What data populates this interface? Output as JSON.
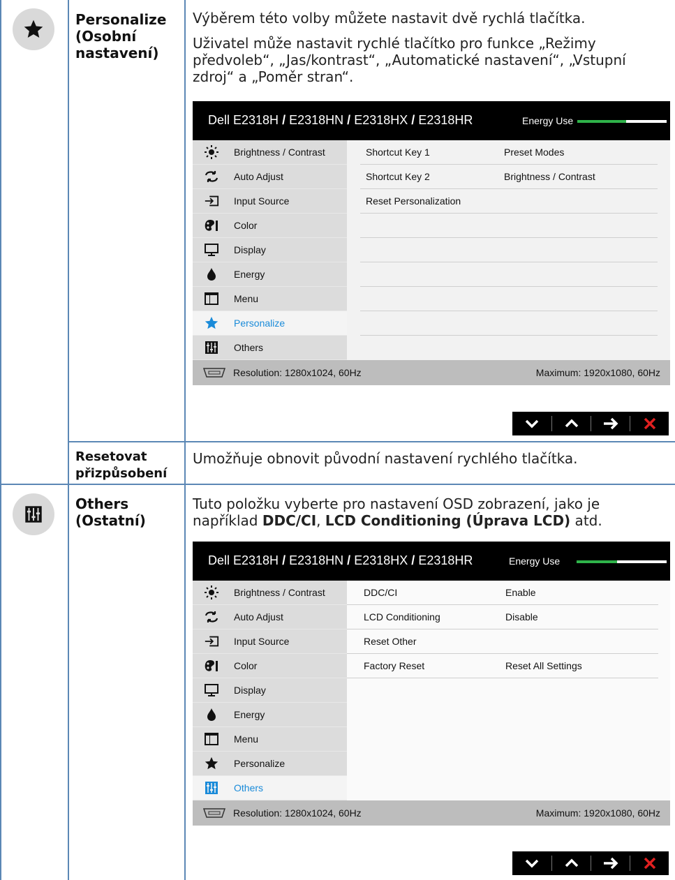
{
  "sections": [
    {
      "icon": "star-icon",
      "name_lines": [
        "Personalize",
        "(Osobní",
        "nastavení)"
      ],
      "desc_lines": [
        "Výběrem této volby můžete nastavit dvě rychlá tlačítka.",
        "Uživatel může nastavit rychlé tlačítko pro funkce „Režimy",
        "předvoleb“, „Jas/kontrast“, „Automatické nastavení“, „Vstupní",
        "zdroj“ a „Poměr stran“."
      ]
    },
    {
      "name_lines": [
        "Resetovat",
        "přizpůsobení"
      ],
      "desc_lines": [
        "Umožňuje obnovit původní nastavení rychlého tlačítka."
      ]
    },
    {
      "icon": "others-icon",
      "name_lines": [
        "Others",
        "(Ostatní)"
      ],
      "desc_line1": "Tuto položku vyberte pro nastavení OSD zobrazení, jako je",
      "desc_line2_prefix": "například ",
      "desc_bold_1": "DDC/CI",
      "desc_sep": ", ",
      "desc_bold_2": "LCD Conditioning (Úprava LCD)",
      "desc_suffix": " atd."
    }
  ],
  "osd1": {
    "models": [
      "Dell E2318H",
      "E2318HN",
      "E2318HX",
      "E2318HR"
    ],
    "separator": "/",
    "energy_label": "Energy Use",
    "energy_level": 0.55,
    "menu": [
      "Brightness / Contrast",
      "Auto Adjust",
      "Input Source",
      "Color",
      "Display",
      "Energy",
      "Menu",
      "Personalize",
      "Others"
    ],
    "selected_index": 7,
    "content": [
      {
        "k": "Shortcut Key 1",
        "v": "Preset Modes"
      },
      {
        "k": "Shortcut Key 2",
        "v": "Brightness / Contrast"
      },
      {
        "k": "Reset Personalization",
        "v": ""
      },
      {
        "k": "",
        "v": ""
      },
      {
        "k": "",
        "v": ""
      },
      {
        "k": "",
        "v": ""
      },
      {
        "k": "",
        "v": ""
      },
      {
        "k": "",
        "v": ""
      }
    ],
    "resolution": "Resolution: 1280x1024, 60Hz",
    "maximum": "Maximum: 1920x1080, 60Hz"
  },
  "osd2": {
    "models": [
      "Dell E2318H",
      "E2318HN",
      "E2318HX",
      "E2318HR"
    ],
    "separator": "/",
    "energy_label": "Energy Use",
    "energy_level": 0.45,
    "menu": [
      "Brightness / Contrast",
      "Auto Adjust",
      "Input Source",
      "Color",
      "Display",
      "Energy",
      "Menu",
      "Personalize",
      "Others"
    ],
    "selected_index": 8,
    "content": [
      {
        "k": "DDC/CI",
        "v": "Enable"
      },
      {
        "k": "LCD Conditioning",
        "v": "Disable"
      },
      {
        "k": "Reset Other",
        "v": ""
      },
      {
        "k": "Factory Reset",
        "v": "Reset All Settings"
      }
    ],
    "resolution": "Resolution: 1280x1024, 60Hz",
    "maximum": "Maximum: 1920x1080, 60Hz"
  },
  "menu_icons": [
    "brightness-icon",
    "auto-adjust-icon",
    "input-source-icon",
    "color-icon",
    "display-icon",
    "energy-icon",
    "menu-icon",
    "personalize-icon",
    "others-icon"
  ],
  "nav_buttons": [
    "down-arrow-icon",
    "up-arrow-icon",
    "right-arrow-icon",
    "close-icon"
  ],
  "colors": {
    "accent": "#1a8bd9",
    "energy": "#2fb34a",
    "close": "#e02020",
    "rule": "#5b87b5"
  }
}
